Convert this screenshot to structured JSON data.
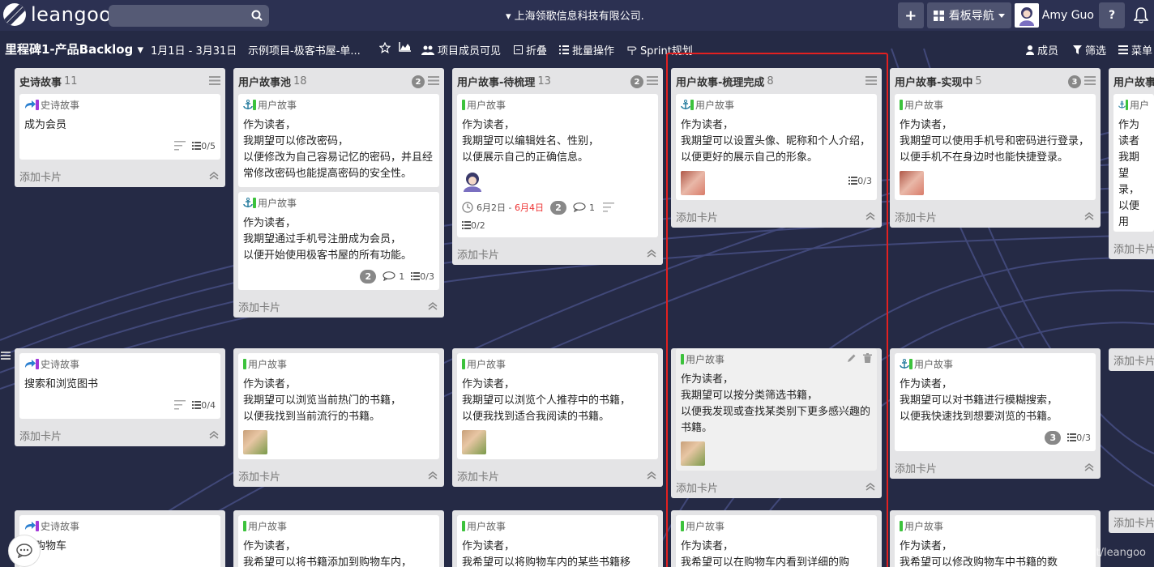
{
  "topbar": {
    "logo_text": "leangoo",
    "search_placeholder": "",
    "org_name": "▾ 上海领歌信息科技有限公司.",
    "board_nav_label": "看板导航",
    "user_name": "Amy Guo",
    "help_label": "?",
    "add_label": "+"
  },
  "board": {
    "title": "里程碑1-产品Backlog ▾",
    "date_range": "1月1日 - 3月31日",
    "project": "示例项目-极客书屋-单...",
    "members_visible": "项目成员可见",
    "collapse": "折叠",
    "batch": "批量操作",
    "sprint": "Sprint规划",
    "members": "成员",
    "filter": "筛选",
    "menu": "菜单"
  },
  "add_card_label": "添加卡片",
  "colors": {
    "background": "#252a45",
    "topbar": "#2c3152",
    "list": "#e4e4e6",
    "highlight": "#e32020",
    "tag_story": "#3cc23c",
    "tag_epic": "#a238d8"
  },
  "lists": [
    {
      "title": "史诗故事",
      "count": "11",
      "cards_row1": [
        {
          "type": "史诗故事",
          "text": "成为会员",
          "checklist": "0/5"
        }
      ],
      "cards_row2": [
        {
          "type": "史诗故事",
          "text": "搜索和浏览图书",
          "checklist": "0/4"
        }
      ],
      "cards_row3": [
        {
          "type": "史诗故事",
          "text": "用购物车"
        }
      ]
    },
    {
      "title": "用户故事池",
      "count": "18",
      "badge": "2",
      "cards_row1": [
        {
          "type": "用户故事",
          "text": "作为读者，\n我期望可以修改密码，\n以便修改为自己容易记忆的密码，并且经常修改密码也能提高密码的安全性。"
        },
        {
          "type": "用户故事",
          "text": "作为读者，\n我期望通过手机号注册成为会员，\n以便开始使用极客书屋的所有功能。",
          "badge": "2",
          "comments": "1",
          "checklist": "0/3"
        }
      ],
      "cards_row2": [
        {
          "type": "用户故事",
          "text": "作为读者，\n我期望可以浏览当前热门的书籍，\n以便我找到当前流行的书籍。"
        }
      ],
      "cards_row3": [
        {
          "type": "用户故事",
          "text": "作为读者，\n我希望可以将书籍添加到购物车内，"
        }
      ]
    },
    {
      "title": "用户故事-待梳理",
      "count": "13",
      "badge": "2",
      "cards_row1": [
        {
          "type": "用户故事",
          "text": "作为读者，\n我期望可以编辑姓名、性别，\n以便展示自己的正确信息。",
          "start": "6月2日",
          "sep": " - ",
          "due": "6月4日",
          "badge": "2",
          "comments": "1",
          "checklist": "0/2"
        }
      ],
      "cards_row2": [
        {
          "type": "用户故事",
          "text": "作为读者，\n我期望可以浏览个人推荐中的书籍，\n以便我找到适合我阅读的书籍。"
        }
      ],
      "cards_row3": [
        {
          "type": "用户故事",
          "text": "作为读者，\n我希望可以将购物车内的某些书籍移"
        }
      ]
    },
    {
      "title": "用户故事-梳理完成",
      "count": "8",
      "cards_row1": [
        {
          "type": "用户故事",
          "text": "作为读者，\n我期望可以设置头像、昵称和个人介绍，\n以便更好的展示自己的形象。",
          "checklist": "0/3"
        }
      ],
      "cards_row2": [
        {
          "type": "用户故事",
          "text": "作为读者，\n我期望可以按分类筛选书籍，\n以便我发现或查找某类别下更多感兴趣的书籍。"
        }
      ],
      "cards_row3": [
        {
          "type": "用户故事",
          "text": "作为读者，\n我希望可以在购物车内看到详细的购"
        }
      ]
    },
    {
      "title": "用户故事-实现中",
      "count": "5",
      "badge": "3",
      "cards_row1": [
        {
          "type": "用户故事",
          "text": "作为读者，\n我期望可以使用手机号和密码进行登录，\n以便手机不在身边时也能快捷登录。"
        }
      ],
      "cards_row2": [
        {
          "type": "用户故事",
          "text": "作为读者，\n我期望可以对书籍进行模糊搜索，\n以便我快速找到想要浏览的书籍。",
          "badge": "3",
          "checklist": "0/3"
        }
      ],
      "cards_row3": [
        {
          "type": "用户故事",
          "text": "作为读者，\n我希望可以修改购物车中书籍的数"
        }
      ]
    },
    {
      "title": "用户故事",
      "cards_row1": [
        {
          "type": "用户",
          "text": "作为读者\n我期望\n录，\n以便用\n的情况"
        }
      ]
    }
  ],
  "watermark": "https://blog.csdn.net/leangoo"
}
